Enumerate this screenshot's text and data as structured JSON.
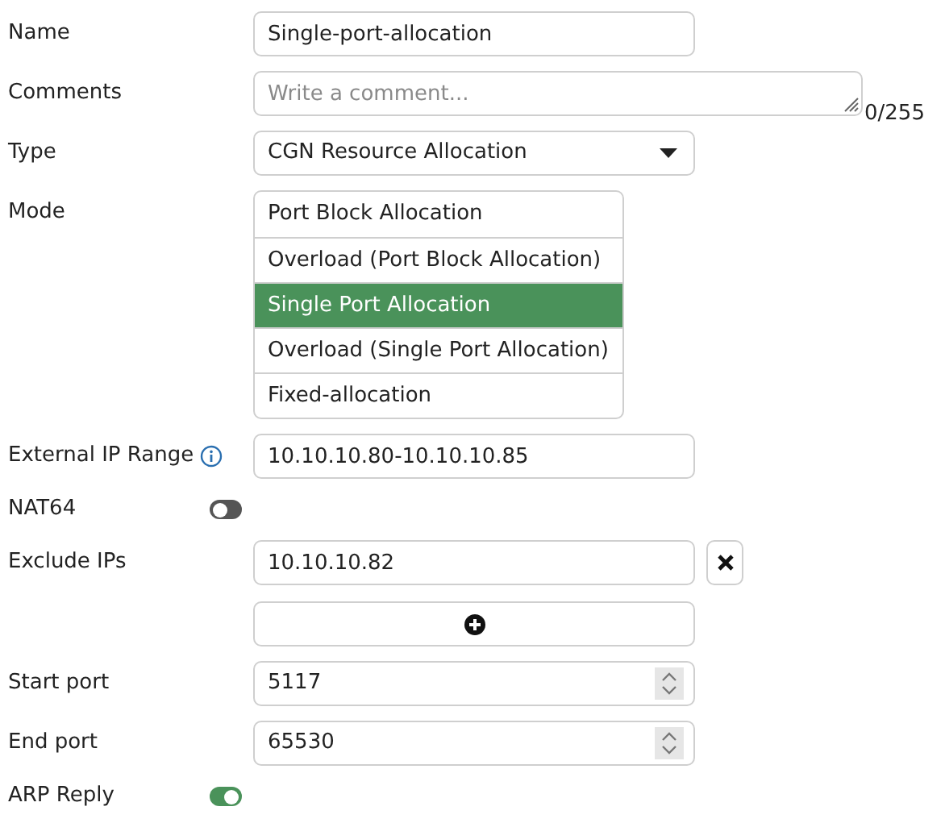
{
  "fields": [
    {
      "kind": "text",
      "label": "Name",
      "value": "Single-port-allocation"
    },
    {
      "kind": "textarea",
      "label": "Comments",
      "placeholder": "Write a comment...",
      "counter": "0/255"
    },
    {
      "kind": "select",
      "label": "Type",
      "value": "CGN Resource Allocation"
    },
    {
      "kind": "list",
      "label": "Mode",
      "options": [
        {
          "label": "Port Block Allocation",
          "selected": false
        },
        {
          "label": "Overload (Port Block Allocation)",
          "selected": false
        },
        {
          "label": "Single Port Allocation",
          "selected": true
        },
        {
          "label": "Overload (Single Port Allocation)",
          "selected": false
        },
        {
          "label": "Fixed-allocation",
          "selected": false
        }
      ]
    },
    {
      "kind": "text",
      "label": "External IP Range",
      "value": "10.10.10.80-10.10.10.85",
      "info": true
    },
    {
      "kind": "toggle",
      "label": "NAT64",
      "on": false
    },
    {
      "kind": "multi",
      "label": "Exclude IPs",
      "values": [
        "10.10.10.82"
      ]
    },
    {
      "kind": "number",
      "label": "Start port",
      "value": "5117"
    },
    {
      "kind": "number",
      "label": "End port",
      "value": "65530"
    },
    {
      "kind": "toggle",
      "label": "ARP Reply",
      "on": true
    }
  ]
}
